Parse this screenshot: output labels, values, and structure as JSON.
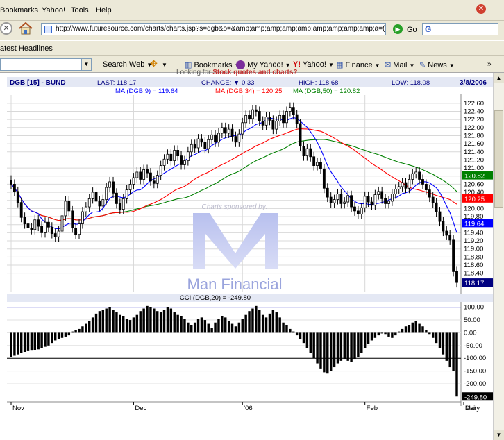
{
  "browser": {
    "menu": [
      "Bookmarks",
      "Yahoo!",
      "Tools",
      "Help"
    ],
    "url": "http://www.futuresource.com/charts/charts.jsp?s=dgb&o=&amp;amp;amp;amp;amp;amp;amp;amp;amp;a=(",
    "go_label": "Go",
    "links_label": "atest Headlines"
  },
  "toolbar": {
    "search_web": "Search Web",
    "bookmarks": "Bookmarks",
    "my_yahoo": "My Yahoo!",
    "yahoo": "Yahoo!",
    "finance": "Finance",
    "mail": "Mail",
    "news": "News"
  },
  "page": {
    "partial_link_prefix": "Looking for",
    "partial_link": "Stock quotes and charts?"
  },
  "chart_header": {
    "symbol": "DGB [15] - BUND",
    "last": "LAST: 118.17",
    "change": "CHANGE: ▼ 0.33",
    "high": "HIGH: 118.68",
    "low": "LOW: 118.08",
    "date": "3/8/2006",
    "ma9": "MA (DGB,9) = 119.64",
    "ma34": "MA (DGB,34) = 120.25",
    "ma50": "MA (DGB,50) = 120.82",
    "cci_title": "CCI (DGB,20) = -249.80",
    "sponsor_text": "Charts sponsored by:",
    "sponsor_name": "Man Financial"
  },
  "colors": {
    "ma9": "#0000ff",
    "ma34": "#ff0000",
    "ma50": "#008000",
    "last_badge": "#000080",
    "header_text": "#000080",
    "sponsor": "#3344bb"
  },
  "chart_data": [
    {
      "type": "candlestick",
      "title": "DGB [15] - BUND",
      "ylim": [
        118.0,
        122.7
      ],
      "y_ticks": [
        118.4,
        118.6,
        118.8,
        119.0,
        119.2,
        119.4,
        119.6,
        119.8,
        120.0,
        120.2,
        120.4,
        120.6,
        120.8,
        121.0,
        121.2,
        121.4,
        121.6,
        121.8,
        122.0,
        122.2,
        122.4,
        122.6
      ],
      "x_labels": [
        "Nov",
        "Dec",
        "'06",
        "Feb",
        "Mar",
        "Daily"
      ],
      "x_label_index": [
        0,
        36,
        68,
        104,
        136,
        148
      ],
      "grid": true,
      "close": [
        120.6,
        120.42,
        120.15,
        119.78,
        119.62,
        119.52,
        119.48,
        119.72,
        119.56,
        119.4,
        119.66,
        119.54,
        119.38,
        119.3,
        119.44,
        119.82,
        120.18,
        119.94,
        119.52,
        119.36,
        119.62,
        119.92,
        120.04,
        120.24,
        120.4,
        120.18,
        120.06,
        120.22,
        120.52,
        120.66,
        120.38,
        120.12,
        119.98,
        120.24,
        120.46,
        120.6,
        120.76,
        120.9,
        120.72,
        120.96,
        120.88,
        120.68,
        120.62,
        120.82,
        121.06,
        121.22,
        121.34,
        121.18,
        121.44,
        121.3,
        121.08,
        121.18,
        121.4,
        121.58,
        121.5,
        121.72,
        121.64,
        121.48,
        121.7,
        121.82,
        121.64,
        121.86,
        122.0,
        121.86,
        121.96,
        121.78,
        121.64,
        121.84,
        122.12,
        122.3,
        122.22,
        122.44,
        122.4,
        122.16,
        122.06,
        122.26,
        122.18,
        121.96,
        122.16,
        122.3,
        122.12,
        122.4,
        122.5,
        122.32,
        122.1,
        121.54,
        121.3,
        121.48,
        121.28,
        121.06,
        121.14,
        120.98,
        120.5,
        120.28,
        120.14,
        120.22,
        120.36,
        120.12,
        120.16,
        120.32,
        120.04,
        119.94,
        119.86,
        120.02,
        120.3,
        120.16,
        120.08,
        120.34,
        120.42,
        120.24,
        120.12,
        120.18,
        120.36,
        120.48,
        120.54,
        120.64,
        120.5,
        120.72,
        120.86,
        120.9,
        120.72,
        120.6,
        120.46,
        120.28,
        120.14,
        119.92,
        119.68,
        119.44,
        119.34,
        119.22,
        118.44,
        118.17
      ],
      "series": [
        {
          "name": "MA (DGB,9)"
        },
        {
          "name": "MA (DGB,34)"
        },
        {
          "name": "MA (DGB,50)"
        }
      ],
      "badges": [
        {
          "label": "120.82",
          "color": "#008000",
          "value": 120.82
        },
        {
          "label": "120.25",
          "color": "#ff0000",
          "value": 120.25
        },
        {
          "label": "119.64",
          "color": "#0000ff",
          "value": 119.64
        },
        {
          "label": "118.17",
          "color": "#000080",
          "value": 118.17
        }
      ]
    },
    {
      "type": "bar",
      "title": "CCI (DGB,20) = -249.80",
      "ylim": [
        -260,
        110
      ],
      "y_ticks": [
        100.0,
        50.0,
        0.0,
        -50.0,
        -100.0,
        -150.0,
        -200.0
      ],
      "y_tick_labels": [
        "100.00",
        "50.00",
        "0.00",
        "-50.00",
        "-100.00",
        "-150.00",
        "-200.00"
      ],
      "reference_lines": [
        100,
        -100
      ],
      "last_label": "-249.80",
      "values": [
        -95,
        -90,
        -85,
        -80,
        -75,
        -72,
        -70,
        -68,
        -65,
        -60,
        -55,
        -50,
        -40,
        -30,
        -25,
        -20,
        -15,
        -10,
        5,
        10,
        15,
        25,
        35,
        45,
        60,
        75,
        85,
        90,
        95,
        100,
        90,
        80,
        70,
        65,
        55,
        50,
        60,
        70,
        85,
        95,
        105,
        100,
        95,
        85,
        80,
        90,
        100,
        95,
        80,
        70,
        65,
        55,
        40,
        30,
        40,
        55,
        60,
        50,
        35,
        20,
        40,
        55,
        65,
        60,
        45,
        35,
        25,
        40,
        55,
        70,
        85,
        95,
        105,
        90,
        70,
        60,
        75,
        90,
        80,
        60,
        40,
        30,
        15,
        5,
        -10,
        -25,
        -40,
        -60,
        -80,
        -100,
        -120,
        -140,
        -155,
        -160,
        -150,
        -135,
        -120,
        -110,
        -105,
        -110,
        -115,
        -105,
        -95,
        -80,
        -60,
        -45,
        -30,
        -20,
        -10,
        0,
        -5,
        -15,
        -20,
        -10,
        5,
        15,
        25,
        30,
        40,
        45,
        35,
        25,
        10,
        -5,
        -20,
        -40,
        -60,
        -85,
        -110,
        -135,
        -150,
        -249.8
      ]
    }
  ]
}
